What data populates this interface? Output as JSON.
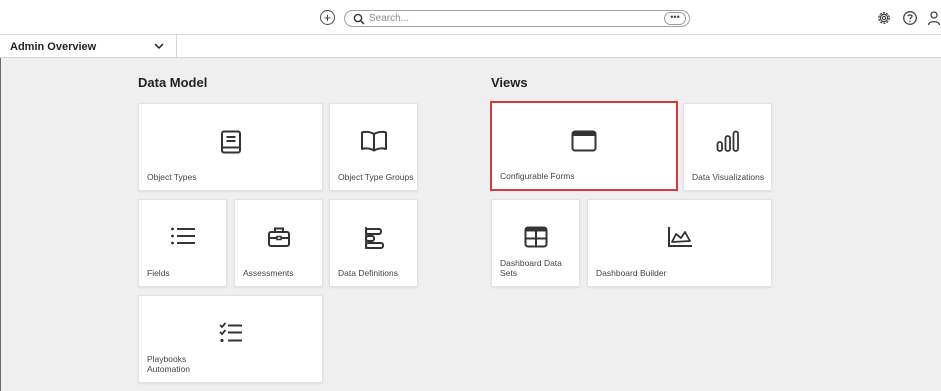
{
  "topbar": {
    "search_placeholder": "Search...",
    "more_label": "•••"
  },
  "subbar": {
    "dashboard_name": "Admin Overview"
  },
  "data_model": {
    "title": "Data Model",
    "tiles": [
      {
        "label": "Object Types",
        "icon": "book-icon"
      },
      {
        "label": "Object Type Groups",
        "icon": "open-book-icon"
      },
      {
        "label": "Fields",
        "icon": "list-icon"
      },
      {
        "label": "Assessments",
        "icon": "briefcase-icon"
      },
      {
        "label": "Data Definitions",
        "icon": "bars-left-icon"
      },
      {
        "label": "Playbooks Automation",
        "icon": "checklist-icon"
      }
    ]
  },
  "views": {
    "title": "Views",
    "tiles": [
      {
        "label": "Configurable Forms",
        "icon": "window-icon",
        "highlighted": true
      },
      {
        "label": "Data Visualizations",
        "icon": "bar-chart-icon"
      },
      {
        "label": "Dashboard Data Sets",
        "icon": "table-icon"
      },
      {
        "label": "Dashboard Builder",
        "icon": "area-chart-icon"
      }
    ]
  },
  "colors": {
    "highlight": "#d63a3a",
    "background": "#efefef"
  }
}
